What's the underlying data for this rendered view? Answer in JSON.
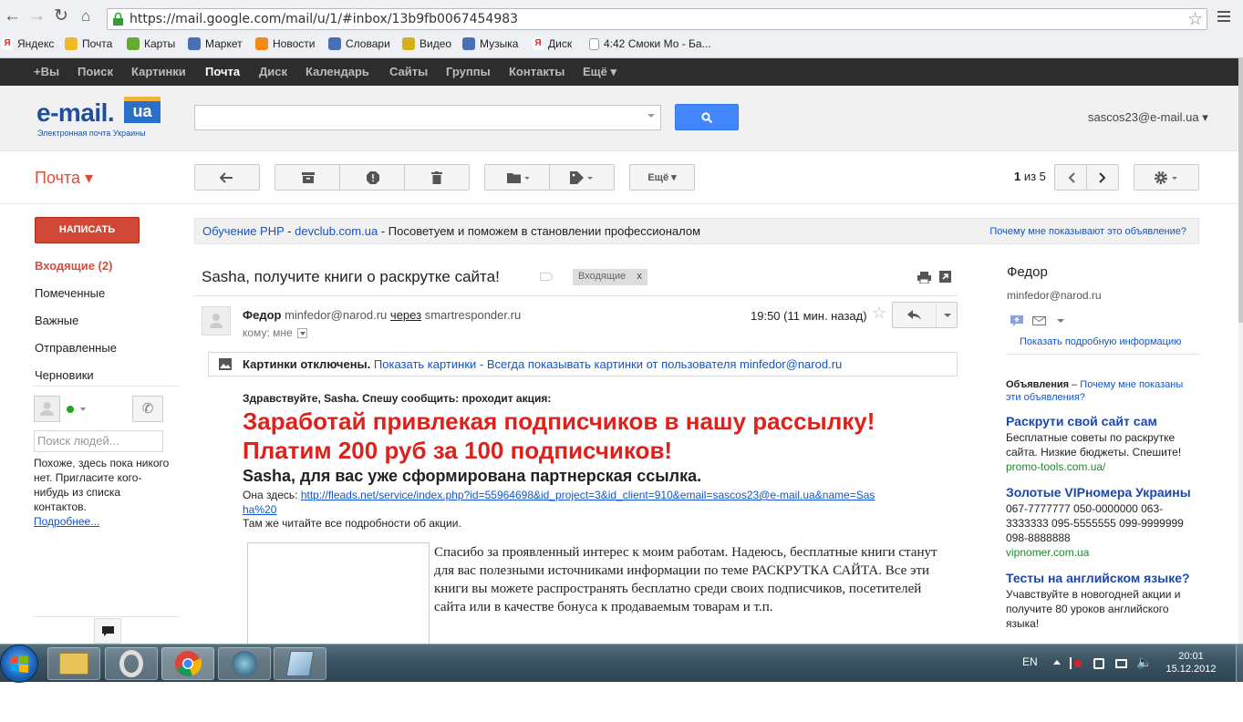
{
  "browser": {
    "url": "https://mail.google.com/mail/u/1/#inbox/13b9fb0067454983",
    "bookmarks": [
      "Яндекс",
      "Почта",
      "Карты",
      "Маркет",
      "Новости",
      "Словари",
      "Видео",
      "Музыка",
      "Диск",
      "4:42 Смоки Мо - Ба..."
    ]
  },
  "gbar": [
    "+Вы",
    "Поиск",
    "Картинки",
    "Почта",
    "Диск",
    "Календарь",
    "Сайты",
    "Группы",
    "Контакты",
    "Ещё ▾"
  ],
  "header": {
    "logo_main": "e-mail.",
    "logo_ua": "ua",
    "logo_sub": "Электронная почта Украины",
    "account": "sascos23@e-mail.ua ▾"
  },
  "toolbar": {
    "mail_label": "Почта ▾",
    "more_label": "Ещё ▾",
    "pager_current": "1",
    "pager_rest": " из 5"
  },
  "nav": {
    "compose": "НАПИСАТЬ",
    "items": [
      "Входящие (2)",
      "Помеченные",
      "Важные",
      "Отправленные",
      "Черновики"
    ],
    "people_placeholder": "Поиск людей...",
    "chat_empty": "Похоже, здесь пока никого нет. Пригласите кого-нибудь из списка контактов.",
    "chat_more": "Подробнее..."
  },
  "adbar": {
    "link1": "Обучение PHP",
    "sep": " - ",
    "link2": "devclub.com.ua",
    "text": " - Посоветуем и поможем в становлении профессионалом",
    "why": "Почему мне показывают это объявление?"
  },
  "message": {
    "subject": "Sasha, получите книги о раскрутке сайта!",
    "label": "Входящие",
    "label_x": "x",
    "from_name": "Федор",
    "from_email": "minfedor@narod.ru",
    "via": "через",
    "via_domain": "smartresponder.ru",
    "to": "кому: мне",
    "time": "19:50 (11 мин. назад)",
    "images_off": "Картинки отключены.",
    "show_images": "Показать картинки",
    "images_sep": " - ",
    "always_show": "Всегда показывать картинки от пользователя minfedor@narod.ru",
    "greet": "Здравствуйте, Sasha. Спешу сообщить: проходит акция:",
    "headline1": "Заработай привлекая подписчиков в нашу рассылку!",
    "headline2": "Платим 200 руб за 100 подписчиков!",
    "subhead": "Sasha, для вас уже сформирована партнерская ссылка.",
    "link_prefix": "Она здесь: ",
    "link_url": "http://fleads.net/service/index.php?id=55964698&id_project=3&id_client=910&email=sascos23@e-mail.ua&name=Sasha%20",
    "more_info": "Там же читайте все подробности об акции.",
    "body_text": "Спасибо за проявленный интерес к моим работам. Надеюсь, бесплатные книги станут для вас полезными источниками информации по теме РАСКРУТКА САЙТА. Все эти книги вы можете распространять бесплатно среди своих подписчиков, посетителей сайта или в качестве бонуса к продаваемым товарам и т.п."
  },
  "contact": {
    "name": "Федор",
    "email": "minfedor@narod.ru",
    "more": "Показать подробную информацию"
  },
  "ads": {
    "head_bold": "Объявления",
    "head_dash": " – ",
    "head_link": "Почему мне показаны эти объявления?",
    "items": [
      {
        "title": "Раскрути свой сайт сам",
        "desc": "Бесплатные советы по раскрутке сайта. Низкие бюджеты. Спешите!",
        "url": "promo-tools.com.ua/"
      },
      {
        "title": "Золотые VIPномера Украины",
        "desc": "067-7777777 050-0000000 063-3333333 095-5555555 099-9999999 098-8888888",
        "url": "vipnomer.com.ua"
      },
      {
        "title": "Тесты на английском языке?",
        "desc": "Учавствуйте в новогодней акции и получите 80 уроков английского языка!",
        "url": ""
      }
    ]
  },
  "taskbar": {
    "lang": "EN",
    "time": "20:01",
    "date": "15.12.2012"
  },
  "colors": {
    "accent": "#dd4b39",
    "link": "#1155cc",
    "search_button": "#4387fd",
    "ad_url": "#1c8a2f",
    "headline": "#e0201a"
  }
}
